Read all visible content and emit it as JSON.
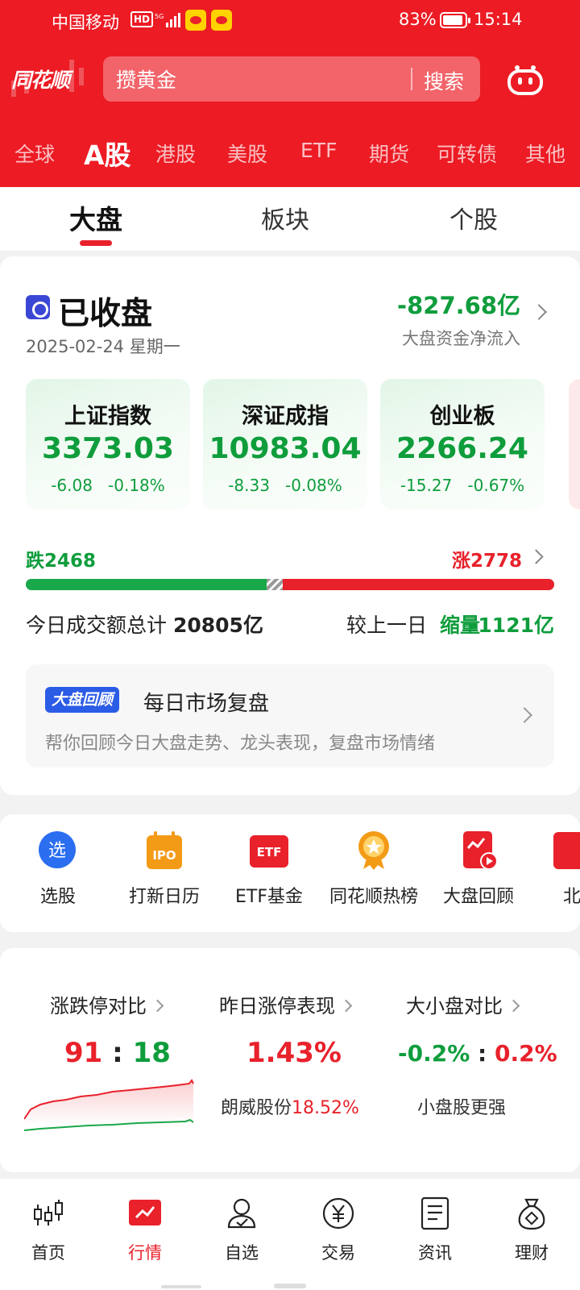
{
  "status_bar": {
    "carrier": "中国移动",
    "hd": "HD",
    "network": "5G",
    "battery": "83%",
    "time": "15:14"
  },
  "header": {
    "logo": "同花顺",
    "search_value": "攒黄金",
    "search_button": "搜索",
    "assistant_icon": "robot-icon"
  },
  "market_tabs": [
    "全球",
    "A股",
    "港股",
    "美股",
    "ETF",
    "期货",
    "可转债",
    "其他"
  ],
  "market_active": "A股",
  "sub_tabs": [
    "大盘",
    "板块",
    "个股"
  ],
  "sub_active": "大盘",
  "overview": {
    "status": "已收盘",
    "date": "2025-02-24 星期一",
    "net_flow": "-827.68亿",
    "net_flow_label": "大盘资金净流入"
  },
  "indices": [
    {
      "name": "上证指数",
      "value": "3373.03",
      "change": "-6.08",
      "pct": "-0.18%"
    },
    {
      "name": "深证成指",
      "value": "10983.04",
      "change": "-8.33",
      "pct": "-0.08%"
    },
    {
      "name": "创业板",
      "value": "2266.24",
      "change": "-15.27",
      "pct": "-0.67%"
    }
  ],
  "breadth": {
    "fall_label": "跌",
    "fall": 2468,
    "rise_label": "涨",
    "rise": 2778,
    "flat_fraction": 0.03
  },
  "turnover": {
    "label": "今日成交额总计",
    "value": "20805亿",
    "compare_label": "较上一日",
    "compare_tag": "缩量",
    "compare_value": "-1121亿"
  },
  "review": {
    "badge": "大盘回顾",
    "title": "每日市场复盘",
    "desc": "帮你回顾今日大盘走势、龙头表现，复盘市场情绪"
  },
  "shortcuts": [
    {
      "label": "选股",
      "icon": "select-stock-icon"
    },
    {
      "label": "打新日历",
      "icon": "ipo-calendar-icon"
    },
    {
      "label": "ETF基金",
      "icon": "etf-icon"
    },
    {
      "label": "同花顺热榜",
      "icon": "hot-list-icon"
    },
    {
      "label": "大盘回顾",
      "icon": "market-review-icon"
    },
    {
      "label": "北",
      "icon": "north-icon"
    }
  ],
  "stats": {
    "limit": {
      "title": "涨跌停对比",
      "up": "91",
      "sep": ":",
      "down": "18"
    },
    "yesterday": {
      "title": "昨日涨停表现",
      "value": "1.43%",
      "stock": "朗威股份",
      "stock_pct": "18.52%"
    },
    "size": {
      "title": "大小盘对比",
      "small": "-0.2%",
      "sep": ":",
      "large": "0.2%",
      "note": "小盘股更强"
    }
  },
  "nav": [
    {
      "label": "首页",
      "icon": "candlestick-home-icon"
    },
    {
      "label": "行情",
      "icon": "market-chart-icon"
    },
    {
      "label": "自选",
      "icon": "watchlist-person-icon"
    },
    {
      "label": "交易",
      "icon": "trade-yen-icon"
    },
    {
      "label": "资讯",
      "icon": "news-doc-icon"
    },
    {
      "label": "理财",
      "icon": "wealth-bag-icon"
    }
  ],
  "nav_active": "行情",
  "colors": {
    "brand_red": "#ec1b24",
    "up_red": "#e8212b",
    "down_green": "#0f9d3c",
    "review_blue": "#2b5ce6"
  }
}
